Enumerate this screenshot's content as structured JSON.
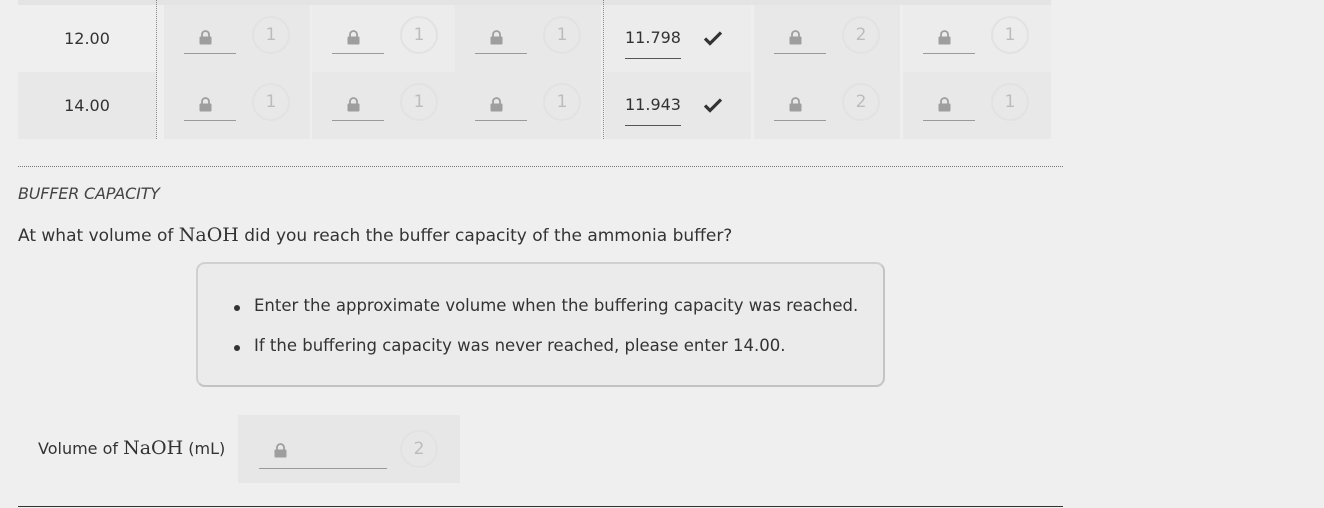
{
  "table": {
    "rows": [
      {
        "volume": "12.00",
        "cells": [
          {
            "type": "locked",
            "points": "1"
          },
          {
            "type": "locked",
            "points": "1"
          },
          {
            "type": "locked",
            "points": "1"
          },
          {
            "type": "answer",
            "value": "11.798",
            "status": "check-icon"
          },
          {
            "type": "locked",
            "points": "2"
          },
          {
            "type": "locked",
            "points": "1"
          }
        ]
      },
      {
        "volume": "14.00",
        "cells": [
          {
            "type": "locked",
            "points": "1"
          },
          {
            "type": "locked",
            "points": "1"
          },
          {
            "type": "locked",
            "points": "1"
          },
          {
            "type": "answer",
            "value": "11.943",
            "status": "check-icon"
          },
          {
            "type": "locked",
            "points": "2"
          },
          {
            "type": "locked",
            "points": "1"
          }
        ]
      }
    ]
  },
  "section": {
    "label": "BUFFER CAPACITY",
    "question_prefix": "At what volume of ",
    "question_math": "NaOH",
    "question_suffix": " did you reach the buffer capacity of the ammonia buffer?"
  },
  "hints": [
    "Enter the approximate volume when the buffering capacity was reached.",
    "If the buffering capacity was never reached, please enter 14.00."
  ],
  "answer": {
    "label_prefix": "Volume of ",
    "label_math": "NaOH",
    "label_suffix": " (mL)",
    "points": "2",
    "lock_icon": "lock-icon"
  },
  "colors": {
    "background": "#efefef",
    "locked_icon": "#9e9e9e",
    "points_text": "#bcbcbc",
    "check": "#333333"
  }
}
